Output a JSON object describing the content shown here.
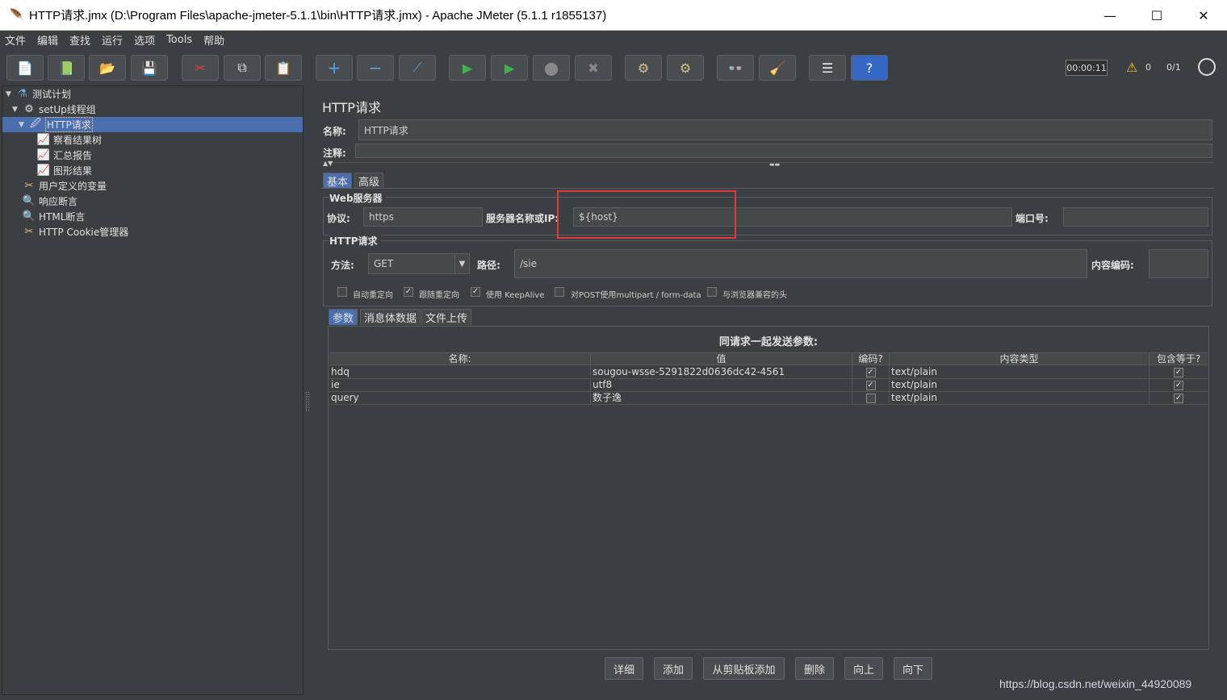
{
  "window": {
    "title": "HTTP请求.jmx (D:\\Program Files\\apache-jmeter-5.1.1\\bin\\HTTP请求.jmx) - Apache JMeter (5.1.1 r1855137)",
    "minimize": "—",
    "maximize": "☐",
    "close": "✕"
  },
  "menu": [
    "文件",
    "编辑",
    "查找",
    "运行",
    "选项",
    "Tools",
    "帮助"
  ],
  "toolbar": {
    "icons": [
      "new-icon",
      "templates-icon",
      "open-icon",
      "save-icon",
      "cut-icon",
      "copy-icon",
      "paste-icon",
      "expand-icon",
      "collapse-icon",
      "toggle-icon",
      "start-icon",
      "start-no-pause-icon",
      "stop-icon",
      "shutdown-icon",
      "clear-icon",
      "clear-all-icon",
      "search-icon",
      "reset-search-icon",
      "function-helper-icon",
      "help-icon"
    ],
    "glyphs": [
      "📄",
      "📗",
      "📂",
      "💾",
      "✂",
      "⧉",
      "📋",
      "+",
      "−",
      "⟋",
      "▶",
      "▶",
      "⬤",
      "✖",
      "⚙",
      "⚙",
      "👓",
      "🧹",
      "☰",
      "?"
    ],
    "timer": "00:00:11",
    "warn_icon": "⚠",
    "warn_count": "0",
    "threads": "0/1"
  },
  "tree": {
    "items": [
      {
        "label": "测试计划",
        "icon": "flask-icon",
        "glyph": "⚗",
        "toggle": "▼"
      },
      {
        "label": "setUp线程组",
        "icon": "gear-icon",
        "glyph": "⚙",
        "toggle": "▼"
      },
      {
        "label": "HTTP请求",
        "icon": "pipette-icon",
        "glyph": "🖉",
        "toggle": "▼"
      },
      {
        "label": "察看结果树",
        "icon": "chart-icon",
        "glyph": "📈",
        "toggle": ""
      },
      {
        "label": "汇总报告",
        "icon": "chart-icon",
        "glyph": "📈",
        "toggle": ""
      },
      {
        "label": "图形结果",
        "icon": "chart-icon",
        "glyph": "📈",
        "toggle": ""
      },
      {
        "label": "用户定义的变量",
        "icon": "tools-icon",
        "glyph": "✂",
        "toggle": ""
      },
      {
        "label": "响应断言",
        "icon": "magnifier-icon",
        "glyph": "🔍",
        "toggle": ""
      },
      {
        "label": "HTML断言",
        "icon": "magnifier-icon",
        "glyph": "🔍",
        "toggle": ""
      },
      {
        "label": "HTTP Cookie管理器",
        "icon": "tools-icon",
        "glyph": "✂",
        "toggle": ""
      }
    ]
  },
  "panel": {
    "title": "HTTP请求",
    "name_label": "名称:",
    "name_value": "HTTP请求",
    "comment_label": "注释:",
    "comment_value": "",
    "tabs": [
      "基本",
      "高级"
    ],
    "web_server_group": "Web服务器",
    "protocol_label": "协议:",
    "protocol_value": "https",
    "server_label": "服务器名称或IP:",
    "server_value": "${host}",
    "port_label": "端口号:",
    "port_value": "",
    "http_group": "HTTP请求",
    "method_label": "方法:",
    "method_value": "GET",
    "path_label": "路径:",
    "path_value": "/sie",
    "encoding_label": "内容编码:",
    "encoding_value": "",
    "options": [
      {
        "label": "自动重定向",
        "checked": false
      },
      {
        "label": "跟随重定向",
        "checked": true
      },
      {
        "label": "使用 KeepAlive",
        "checked": true
      },
      {
        "label": "对POST使用multipart / form-data",
        "checked": false
      },
      {
        "label": "与浏览器兼容的头",
        "checked": false
      }
    ],
    "subtabs": [
      "参数",
      "消息体数据",
      "文件上传"
    ],
    "params_caption": "同请求一起发送参数:",
    "columns": [
      "名称:",
      "值",
      "编码?",
      "内容类型",
      "包含等于?"
    ],
    "rows": [
      {
        "name": "hdq",
        "value": "sougou-wsse-5291822d0636dc42-4561",
        "encode": true,
        "content_type": "text/plain",
        "include_equals": true
      },
      {
        "name": "ie",
        "value": "utf8",
        "encode": true,
        "content_type": "text/plain",
        "include_equals": true
      },
      {
        "name": "query",
        "value": "数子逸",
        "encode": false,
        "content_type": "text/plain",
        "include_equals": true
      }
    ],
    "buttons": [
      "详细",
      "添加",
      "从剪贴板添加",
      "删除",
      "向上",
      "向下"
    ]
  },
  "watermark": "https://blog.csdn.net/weixin_44920089"
}
